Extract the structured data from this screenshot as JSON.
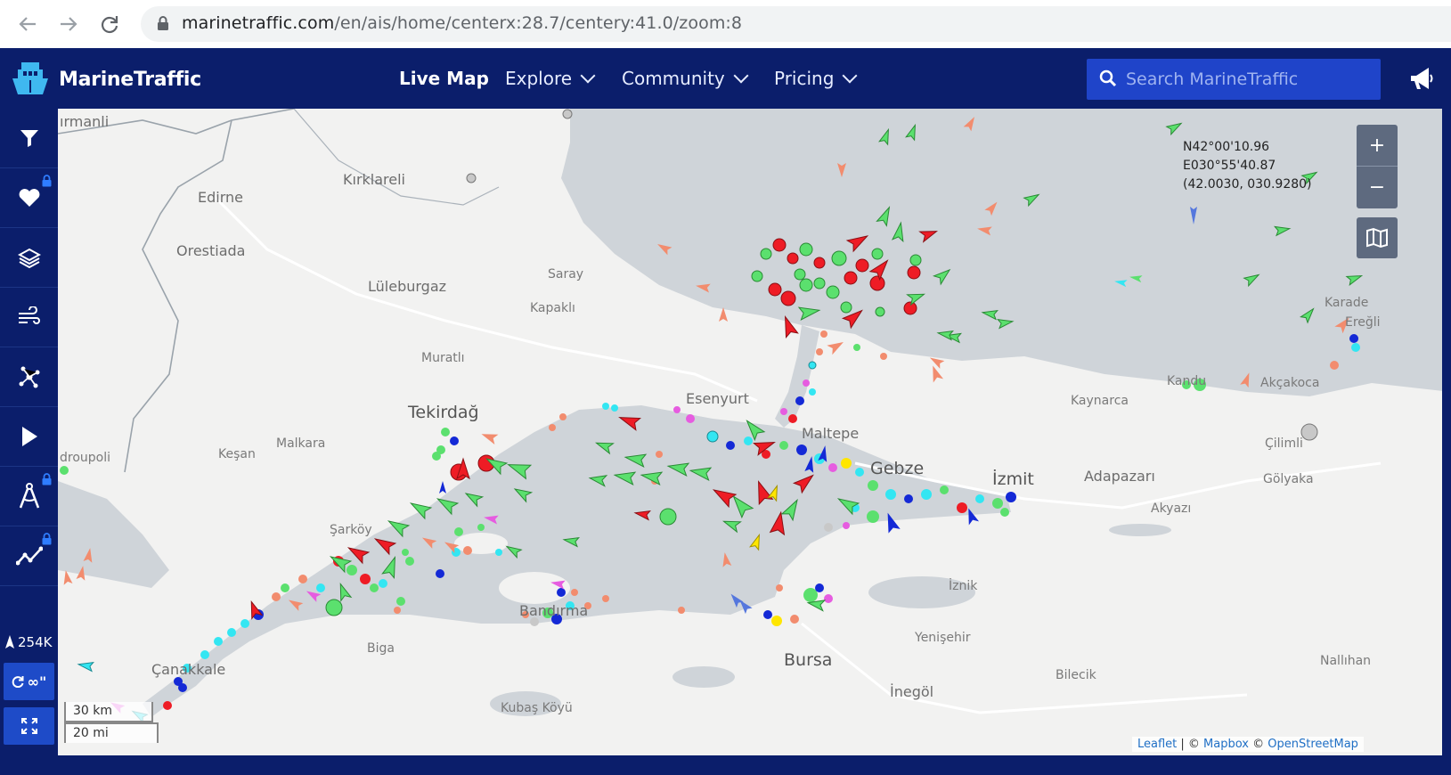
{
  "browser": {
    "url_domain": "marinetraffic.com",
    "url_path": "/en/ais/home/centerx:28.7/centery:41.0/zoom:8",
    "back_icon": "arrow-left-icon",
    "forward_icon": "arrow-right-icon",
    "reload_icon": "reload-icon",
    "lock_icon": "lock-icon"
  },
  "header": {
    "logo_text": "MarineTraffic",
    "nav": [
      {
        "label": "Live Map",
        "active": true
      },
      {
        "label": "Explore",
        "dropdown": true
      },
      {
        "label": "Community",
        "dropdown": true
      },
      {
        "label": "Pricing",
        "dropdown": true
      }
    ],
    "search_placeholder": "Search MarineTraffic",
    "announcement_icon": "megaphone-icon"
  },
  "sidebar": {
    "tools": [
      {
        "name": "filters",
        "icon": "filter-icon",
        "locked": false
      },
      {
        "name": "my-fleets",
        "icon": "heart-icon",
        "locked": true
      },
      {
        "name": "map-layers",
        "icon": "layers-icon",
        "locked": false
      },
      {
        "name": "weather",
        "icon": "wind-icon",
        "locked": false
      },
      {
        "name": "routes",
        "icon": "network-icon",
        "locked": false
      },
      {
        "name": "playback",
        "icon": "play-icon",
        "locked": false
      },
      {
        "name": "measure-distance",
        "icon": "compass-icon",
        "locked": true
      },
      {
        "name": "voyage-planner",
        "icon": "chart-line-icon",
        "locked": true
      }
    ],
    "vessel_count": "254K",
    "refresh_label": "∞\"",
    "fullscreen_icon": "fullscreen-icon"
  },
  "map": {
    "coordinates": {
      "lat": "N42°00'10.96",
      "lon": "E030°55'40.87",
      "decimal": "(42.0030, 030.9280)"
    },
    "zoom_in": "+",
    "zoom_out": "−",
    "layers_icon": "map-icon",
    "scale_km": "30 km",
    "scale_mi": "20 mi",
    "attribution": {
      "leaflet": "Leaflet",
      "sep": " | © ",
      "mapbox": "Mapbox",
      "sep2": " © ",
      "osm": "OpenStreetMap"
    },
    "places": [
      {
        "name": "ırmanli",
        "cls": "mid"
      },
      {
        "name": "Kırklareli",
        "cls": "mid"
      },
      {
        "name": "Edirne",
        "cls": "mid"
      },
      {
        "name": "Orestiada",
        "cls": "mid"
      },
      {
        "name": "Lüleburgaz",
        "cls": "mid"
      },
      {
        "name": "Saray",
        "cls": "sm"
      },
      {
        "name": "Kapaklı",
        "cls": "sm"
      },
      {
        "name": "Muratlı",
        "cls": "sm"
      },
      {
        "name": "Tekirdağ",
        "cls": "big"
      },
      {
        "name": "Esenyurt",
        "cls": "mid"
      },
      {
        "name": "Malkara",
        "cls": "sm"
      },
      {
        "name": "Keşan",
        "cls": "sm"
      },
      {
        "name": "droupoli",
        "cls": "sm"
      },
      {
        "name": "Maltepe",
        "cls": "mid"
      },
      {
        "name": "Gebze",
        "cls": "big"
      },
      {
        "name": "İzmit",
        "cls": "big"
      },
      {
        "name": "Adapazarı",
        "cls": "mid"
      },
      {
        "name": "Kaynarca",
        "cls": "sm"
      },
      {
        "name": "Çilimli",
        "cls": "sm"
      },
      {
        "name": "Gölyaka",
        "cls": "sm"
      },
      {
        "name": "Akyazı",
        "cls": "sm"
      },
      {
        "name": "Akçakoca",
        "cls": "sm"
      },
      {
        "name": "Kandu",
        "cls": "sm"
      },
      {
        "name": "Karade",
        "cls": "sm"
      },
      {
        "name": "Ereğli",
        "cls": "sm"
      },
      {
        "name": "Şarköy",
        "cls": "sm"
      },
      {
        "name": "Biga",
        "cls": "sm"
      },
      {
        "name": "Çanakkale",
        "cls": "mid"
      },
      {
        "name": "Bandırma",
        "cls": "mid"
      },
      {
        "name": "Kubaş Köyü",
        "cls": "sm"
      },
      {
        "name": "Bursa",
        "cls": "big"
      },
      {
        "name": "İznik",
        "cls": "sm"
      },
      {
        "name": "Yenişehir",
        "cls": "sm"
      },
      {
        "name": "İnegöl",
        "cls": "mid"
      },
      {
        "name": "Bilecik",
        "cls": "sm"
      },
      {
        "name": "Nallıhan",
        "cls": "sm"
      }
    ],
    "colors": {
      "land": "#f2f2f1",
      "water": "#cfd4d9",
      "cargo_green": "#5be06e",
      "tanker_red": "#ee1c25",
      "passenger_blue": "#1429d6",
      "tug_cyan": "#33e6f2",
      "fishing_salmon": "#f28c6e",
      "pleasure_magenta": "#e65ce0",
      "highspeed_yellow": "#ffe600",
      "unknown_gray": "#c8c8c8"
    }
  }
}
